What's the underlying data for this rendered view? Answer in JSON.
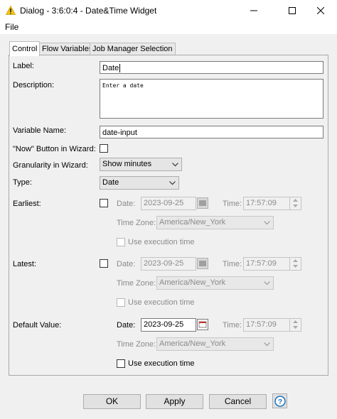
{
  "window": {
    "title": "Dialog - 3:6:0:4 - Date&Time Widget"
  },
  "menu": {
    "file": "File"
  },
  "tabs": [
    "Control",
    "Flow Variables",
    "Job Manager Selection"
  ],
  "form": {
    "label_label": "Label:",
    "label_value": "Date",
    "description_label": "Description:",
    "description_value": "Enter a date",
    "variable_name_label": "Variable Name:",
    "variable_name_value": "date-input",
    "now_button_label": "\"Now\" Button in Wizard:",
    "granularity_label": "Granularity in Wizard:",
    "granularity_value": "Show minutes",
    "type_label": "Type:",
    "type_value": "Date"
  },
  "earliest": {
    "label": "Earliest:",
    "date_label": "Date:",
    "date_value": "2023-09-25",
    "time_label": "Time:",
    "time_value": "17:57:09",
    "timezone_label": "Time Zone:",
    "timezone_value": "America/New_York",
    "exec_time_label": "Use execution time"
  },
  "latest": {
    "label": "Latest:",
    "date_label": "Date:",
    "date_value": "2023-09-25",
    "time_label": "Time:",
    "time_value": "17:57:09",
    "timezone_label": "Time Zone:",
    "timezone_value": "America/New_York",
    "exec_time_label": "Use execution time"
  },
  "default_value": {
    "label": "Default Value:",
    "date_label": "Date:",
    "date_value": "2023-09-25",
    "time_label": "Time:",
    "time_value": "17:57:09",
    "timezone_label": "Time Zone:",
    "timezone_value": "America/New_York",
    "exec_time_label": "Use execution time"
  },
  "buttons": {
    "ok": "OK",
    "apply": "Apply",
    "cancel": "Cancel",
    "help": "?"
  },
  "colors": {
    "warning": "#f5c518",
    "help_ring": "#1e73be"
  }
}
